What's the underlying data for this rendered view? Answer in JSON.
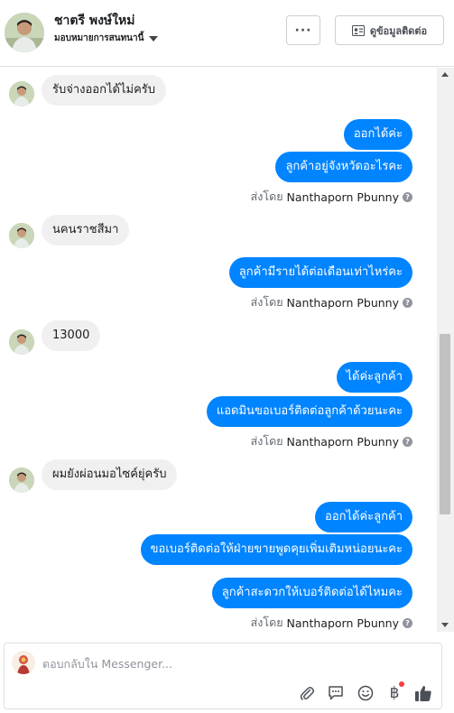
{
  "header": {
    "contact_name": "ชาตรี พงษ์ใหม่",
    "assigned_label": "มอบหมายการสนทนานี้",
    "more_label": "···",
    "view_contact_label": "ดูข้อมูลติดต่อ"
  },
  "messages": [
    {
      "side": "in",
      "text": "รับจ่างออกได้ไม่ครับ"
    },
    {
      "side": "out",
      "text": "ออกได้ค่ะ"
    },
    {
      "side": "out",
      "text": "ลูกค้าอยู่จังหวัดอะไรคะ"
    },
    {
      "side": "in",
      "text": "นคนราชสีมา"
    },
    {
      "side": "out",
      "text": "ลูกค้ามีรายได้ต่อเดือนเท่าไหร่คะ"
    },
    {
      "side": "in",
      "text": "13000"
    },
    {
      "side": "out",
      "text": "ได้ค่ะลูกค้า"
    },
    {
      "side": "out",
      "text": "แอดมินขอเบอร์ติดต่อลูกค้าด้วยนะคะ"
    },
    {
      "side": "in",
      "text": "ผมยังผ่อนมอไซค์ยุ่ครับ"
    },
    {
      "side": "out",
      "text": "ออกได้ค่ะลูกค้า"
    },
    {
      "side": "out",
      "text": "ขอเบอร์ติดต่อให้ฝ่ายขายพูดคุยเพิ่มเติมหน่อยนะคะ"
    },
    {
      "side": "out",
      "text": "ลูกค้าสะดวกให้เบอร์ติดต่อได้ไหมคะ"
    }
  ],
  "sent_by": {
    "prefix": "ส่งโดย",
    "name": "Nanthaporn Pbunny",
    "help_glyph": "?"
  },
  "composer": {
    "placeholder": "ตอบกลับใน Messenger...",
    "baht_glyph": "฿"
  },
  "colors": {
    "outgoing_bubble": "#0084ff",
    "incoming_bubble": "#f1f0f0",
    "like_icon": "#4b4f56",
    "notification_dot": "#fa3e3e"
  }
}
